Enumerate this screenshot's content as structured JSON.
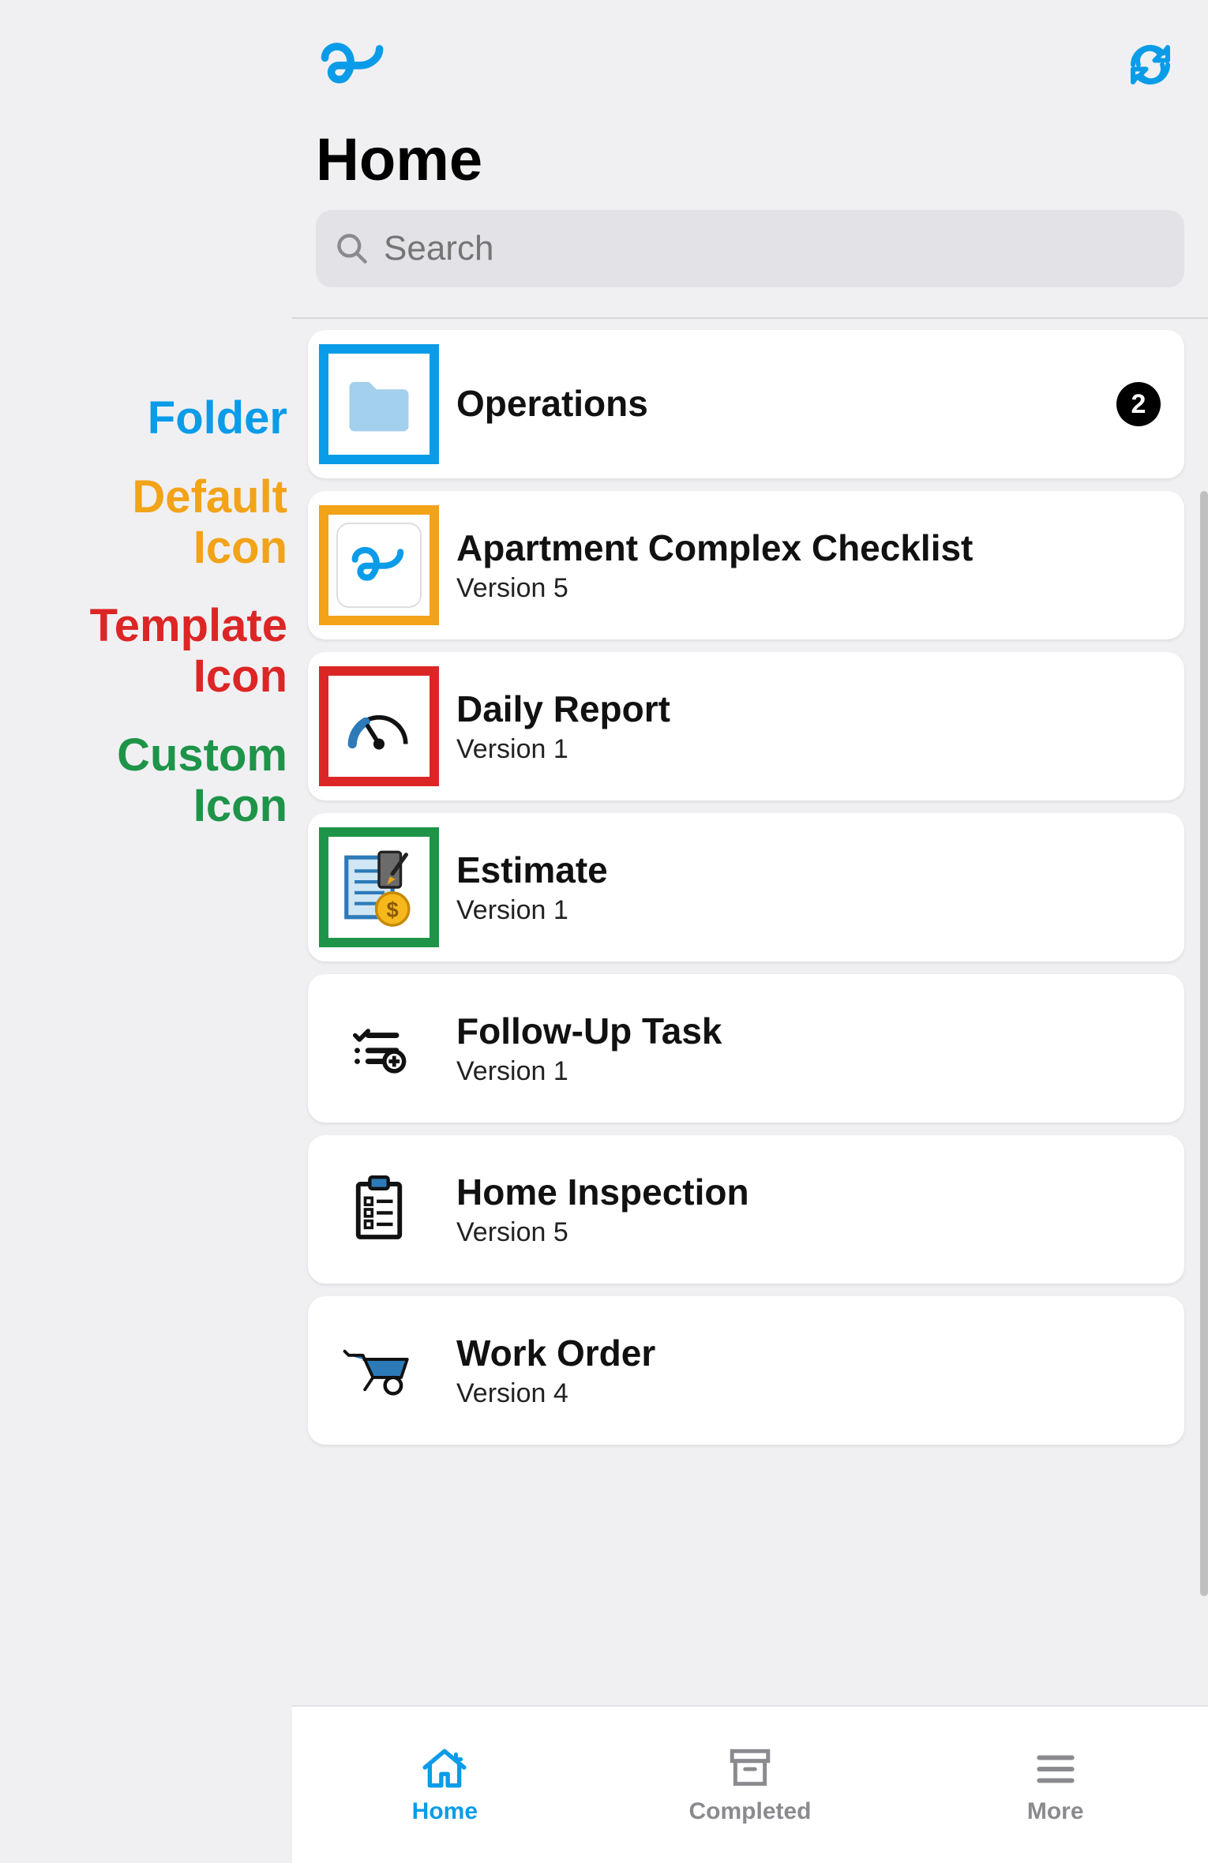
{
  "annotations": {
    "folder": "Folder",
    "default1": "Default",
    "default2": "Icon",
    "template1": "Template",
    "template2": "Icon",
    "custom1": "Custom",
    "custom2": "Icon"
  },
  "header": {
    "title": "Home"
  },
  "search": {
    "placeholder": "Search"
  },
  "items": [
    {
      "title": "Operations",
      "sub": "",
      "badge": "2",
      "iconType": "folder",
      "border": "blue"
    },
    {
      "title": "Apartment Complex Checklist",
      "sub": "Version 5",
      "badge": "",
      "iconType": "default",
      "border": "orange"
    },
    {
      "title": "Daily Report",
      "sub": "Version 1",
      "badge": "",
      "iconType": "gauge",
      "border": "red"
    },
    {
      "title": "Estimate",
      "sub": "Version 1",
      "badge": "",
      "iconType": "estimate",
      "border": "green"
    },
    {
      "title": "Follow-Up Task",
      "sub": "Version 1",
      "badge": "",
      "iconType": "checklist-add",
      "border": ""
    },
    {
      "title": "Home Inspection",
      "sub": "Version 5",
      "badge": "",
      "iconType": "clipboard",
      "border": ""
    },
    {
      "title": "Work Order",
      "sub": "Version 4",
      "badge": "",
      "iconType": "wheelbarrow",
      "border": ""
    }
  ],
  "tabs": {
    "home": "Home",
    "completed": "Completed",
    "more": "More"
  },
  "colors": {
    "accent": "#0a9ce8",
    "orange": "#f2a318",
    "red": "#dc2626",
    "green": "#1e9449"
  }
}
